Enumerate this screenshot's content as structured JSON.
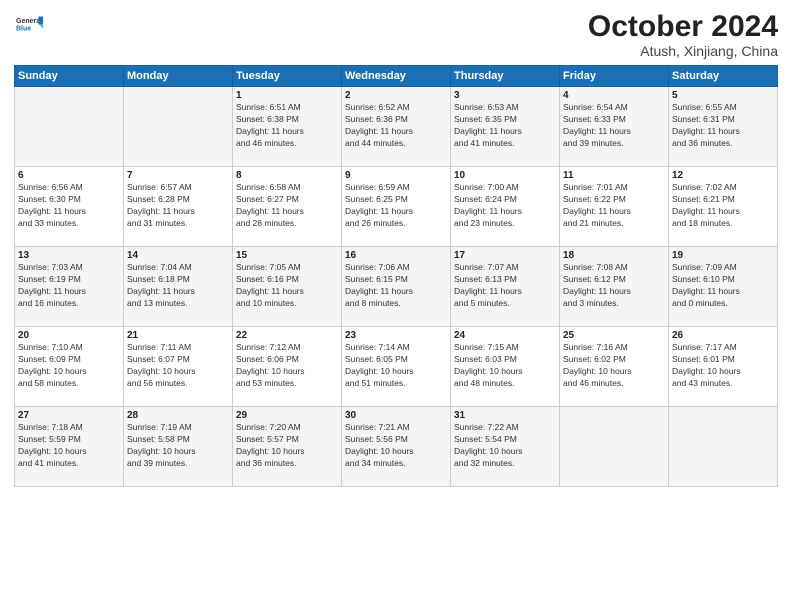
{
  "logo": {
    "line1": "General",
    "line2": "Blue"
  },
  "title": "October 2024",
  "subtitle": "Atush, Xinjiang, China",
  "days_of_week": [
    "Sunday",
    "Monday",
    "Tuesday",
    "Wednesday",
    "Thursday",
    "Friday",
    "Saturday"
  ],
  "weeks": [
    [
      {
        "num": "",
        "sunrise": "",
        "sunset": "",
        "daylight": ""
      },
      {
        "num": "",
        "sunrise": "",
        "sunset": "",
        "daylight": ""
      },
      {
        "num": "1",
        "sunrise": "Sunrise: 6:51 AM",
        "sunset": "Sunset: 6:38 PM",
        "daylight": "Daylight: 11 hours and 46 minutes."
      },
      {
        "num": "2",
        "sunrise": "Sunrise: 6:52 AM",
        "sunset": "Sunset: 6:36 PM",
        "daylight": "Daylight: 11 hours and 44 minutes."
      },
      {
        "num": "3",
        "sunrise": "Sunrise: 6:53 AM",
        "sunset": "Sunset: 6:35 PM",
        "daylight": "Daylight: 11 hours and 41 minutes."
      },
      {
        "num": "4",
        "sunrise": "Sunrise: 6:54 AM",
        "sunset": "Sunset: 6:33 PM",
        "daylight": "Daylight: 11 hours and 39 minutes."
      },
      {
        "num": "5",
        "sunrise": "Sunrise: 6:55 AM",
        "sunset": "Sunset: 6:31 PM",
        "daylight": "Daylight: 11 hours and 36 minutes."
      }
    ],
    [
      {
        "num": "6",
        "sunrise": "Sunrise: 6:56 AM",
        "sunset": "Sunset: 6:30 PM",
        "daylight": "Daylight: 11 hours and 33 minutes."
      },
      {
        "num": "7",
        "sunrise": "Sunrise: 6:57 AM",
        "sunset": "Sunset: 6:28 PM",
        "daylight": "Daylight: 11 hours and 31 minutes."
      },
      {
        "num": "8",
        "sunrise": "Sunrise: 6:58 AM",
        "sunset": "Sunset: 6:27 PM",
        "daylight": "Daylight: 11 hours and 28 minutes."
      },
      {
        "num": "9",
        "sunrise": "Sunrise: 6:59 AM",
        "sunset": "Sunset: 6:25 PM",
        "daylight": "Daylight: 11 hours and 26 minutes."
      },
      {
        "num": "10",
        "sunrise": "Sunrise: 7:00 AM",
        "sunset": "Sunset: 6:24 PM",
        "daylight": "Daylight: 11 hours and 23 minutes."
      },
      {
        "num": "11",
        "sunrise": "Sunrise: 7:01 AM",
        "sunset": "Sunset: 6:22 PM",
        "daylight": "Daylight: 11 hours and 21 minutes."
      },
      {
        "num": "12",
        "sunrise": "Sunrise: 7:02 AM",
        "sunset": "Sunset: 6:21 PM",
        "daylight": "Daylight: 11 hours and 18 minutes."
      }
    ],
    [
      {
        "num": "13",
        "sunrise": "Sunrise: 7:03 AM",
        "sunset": "Sunset: 6:19 PM",
        "daylight": "Daylight: 11 hours and 16 minutes."
      },
      {
        "num": "14",
        "sunrise": "Sunrise: 7:04 AM",
        "sunset": "Sunset: 6:18 PM",
        "daylight": "Daylight: 11 hours and 13 minutes."
      },
      {
        "num": "15",
        "sunrise": "Sunrise: 7:05 AM",
        "sunset": "Sunset: 6:16 PM",
        "daylight": "Daylight: 11 hours and 10 minutes."
      },
      {
        "num": "16",
        "sunrise": "Sunrise: 7:06 AM",
        "sunset": "Sunset: 6:15 PM",
        "daylight": "Daylight: 11 hours and 8 minutes."
      },
      {
        "num": "17",
        "sunrise": "Sunrise: 7:07 AM",
        "sunset": "Sunset: 6:13 PM",
        "daylight": "Daylight: 11 hours and 5 minutes."
      },
      {
        "num": "18",
        "sunrise": "Sunrise: 7:08 AM",
        "sunset": "Sunset: 6:12 PM",
        "daylight": "Daylight: 11 hours and 3 minutes."
      },
      {
        "num": "19",
        "sunrise": "Sunrise: 7:09 AM",
        "sunset": "Sunset: 6:10 PM",
        "daylight": "Daylight: 11 hours and 0 minutes."
      }
    ],
    [
      {
        "num": "20",
        "sunrise": "Sunrise: 7:10 AM",
        "sunset": "Sunset: 6:09 PM",
        "daylight": "Daylight: 10 hours and 58 minutes."
      },
      {
        "num": "21",
        "sunrise": "Sunrise: 7:11 AM",
        "sunset": "Sunset: 6:07 PM",
        "daylight": "Daylight: 10 hours and 56 minutes."
      },
      {
        "num": "22",
        "sunrise": "Sunrise: 7:12 AM",
        "sunset": "Sunset: 6:06 PM",
        "daylight": "Daylight: 10 hours and 53 minutes."
      },
      {
        "num": "23",
        "sunrise": "Sunrise: 7:14 AM",
        "sunset": "Sunset: 6:05 PM",
        "daylight": "Daylight: 10 hours and 51 minutes."
      },
      {
        "num": "24",
        "sunrise": "Sunrise: 7:15 AM",
        "sunset": "Sunset: 6:03 PM",
        "daylight": "Daylight: 10 hours and 48 minutes."
      },
      {
        "num": "25",
        "sunrise": "Sunrise: 7:16 AM",
        "sunset": "Sunset: 6:02 PM",
        "daylight": "Daylight: 10 hours and 46 minutes."
      },
      {
        "num": "26",
        "sunrise": "Sunrise: 7:17 AM",
        "sunset": "Sunset: 6:01 PM",
        "daylight": "Daylight: 10 hours and 43 minutes."
      }
    ],
    [
      {
        "num": "27",
        "sunrise": "Sunrise: 7:18 AM",
        "sunset": "Sunset: 5:59 PM",
        "daylight": "Daylight: 10 hours and 41 minutes."
      },
      {
        "num": "28",
        "sunrise": "Sunrise: 7:19 AM",
        "sunset": "Sunset: 5:58 PM",
        "daylight": "Daylight: 10 hours and 39 minutes."
      },
      {
        "num": "29",
        "sunrise": "Sunrise: 7:20 AM",
        "sunset": "Sunset: 5:57 PM",
        "daylight": "Daylight: 10 hours and 36 minutes."
      },
      {
        "num": "30",
        "sunrise": "Sunrise: 7:21 AM",
        "sunset": "Sunset: 5:56 PM",
        "daylight": "Daylight: 10 hours and 34 minutes."
      },
      {
        "num": "31",
        "sunrise": "Sunrise: 7:22 AM",
        "sunset": "Sunset: 5:54 PM",
        "daylight": "Daylight: 10 hours and 32 minutes."
      },
      {
        "num": "",
        "sunrise": "",
        "sunset": "",
        "daylight": ""
      },
      {
        "num": "",
        "sunrise": "",
        "sunset": "",
        "daylight": ""
      }
    ]
  ]
}
